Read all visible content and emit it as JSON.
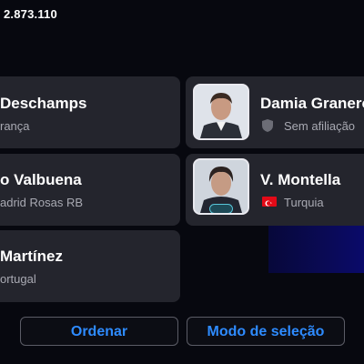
{
  "header": {
    "coins": "2.873.110"
  },
  "coaches": [
    {
      "name": "Deschamps",
      "club": "rança"
    },
    {
      "name": "Damia Granero",
      "club": "Sem afiliação"
    },
    {
      "name": "o Valbuena",
      "club": "adrid Rosas RB"
    },
    {
      "name": "V. Montella",
      "club": "Turquia"
    },
    {
      "name": "Martínez",
      "club": "ortugal"
    }
  ],
  "buttons": {
    "sort": "Ordenar",
    "select_mode": "Modo de seleção"
  },
  "colors": {
    "accent": "#2e8bff",
    "card": "#24252d",
    "background": "#07080f",
    "flag_turkey": "#e30a17"
  },
  "icons": {
    "unaffiliated": "shield-icon",
    "country_turkey": "turkey-flag-icon"
  }
}
